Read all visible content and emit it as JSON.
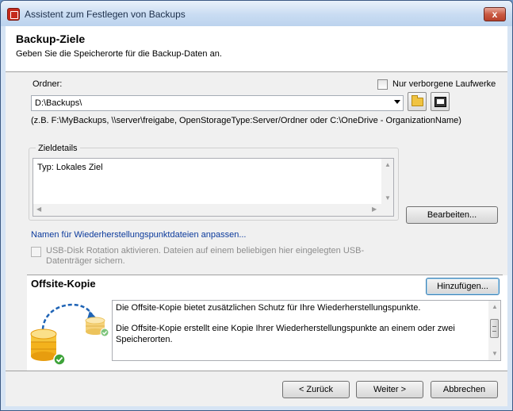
{
  "window": {
    "title": "Assistent zum Festlegen von Backups",
    "close_glyph": "x"
  },
  "header": {
    "title": "Backup-Ziele",
    "subtitle": "Geben Sie die Speicherorte für die Backup-Daten an."
  },
  "folder": {
    "label": "Ordner:",
    "value": "D:\\Backups\\",
    "hidden_drives_label": "Nur verborgene Laufwerke",
    "hidden_drives_checked": false,
    "hint": "(z.B. F:\\MyBackups, \\\\server\\freigabe, OpenStorageType:Server/Ordner oder C:\\OneDrive - OrganizationName)"
  },
  "target_details": {
    "group_title": "Zieldetails",
    "text": "Typ: Lokales Ziel",
    "edit_button": "Bearbeiten..."
  },
  "rename_link": "Namen für Wiederherstellungspunktdateien anpassen...",
  "usb_rotation": {
    "label": "USB-Disk Rotation aktivieren. Dateien auf einem beliebigen hier eingelegten USB-Datenträger sichern.",
    "checked": false,
    "enabled": false
  },
  "offsite": {
    "title": "Offsite-Kopie",
    "add_button": "Hinzufügen...",
    "paragraph1": "Die Offsite-Kopie bietet zusätzlichen Schutz für Ihre Wiederherstellungspunkte.",
    "paragraph2": "Die Offsite-Kopie erstellt eine Kopie Ihrer Wiederherstellungspunkte an einem oder zwei Speicherorten."
  },
  "footer": {
    "back": "< Zurück",
    "next": "Weiter >",
    "cancel": "Abbrechen"
  },
  "icons": [
    "app-icon",
    "close-icon",
    "folder-icon",
    "network-folder-icon",
    "database-icon",
    "checkmark-icon"
  ],
  "colors": {
    "link": "#0b3a9c",
    "accent": "#3c7fb1",
    "check": "#3ea33a",
    "disk": "#f3b21d"
  }
}
